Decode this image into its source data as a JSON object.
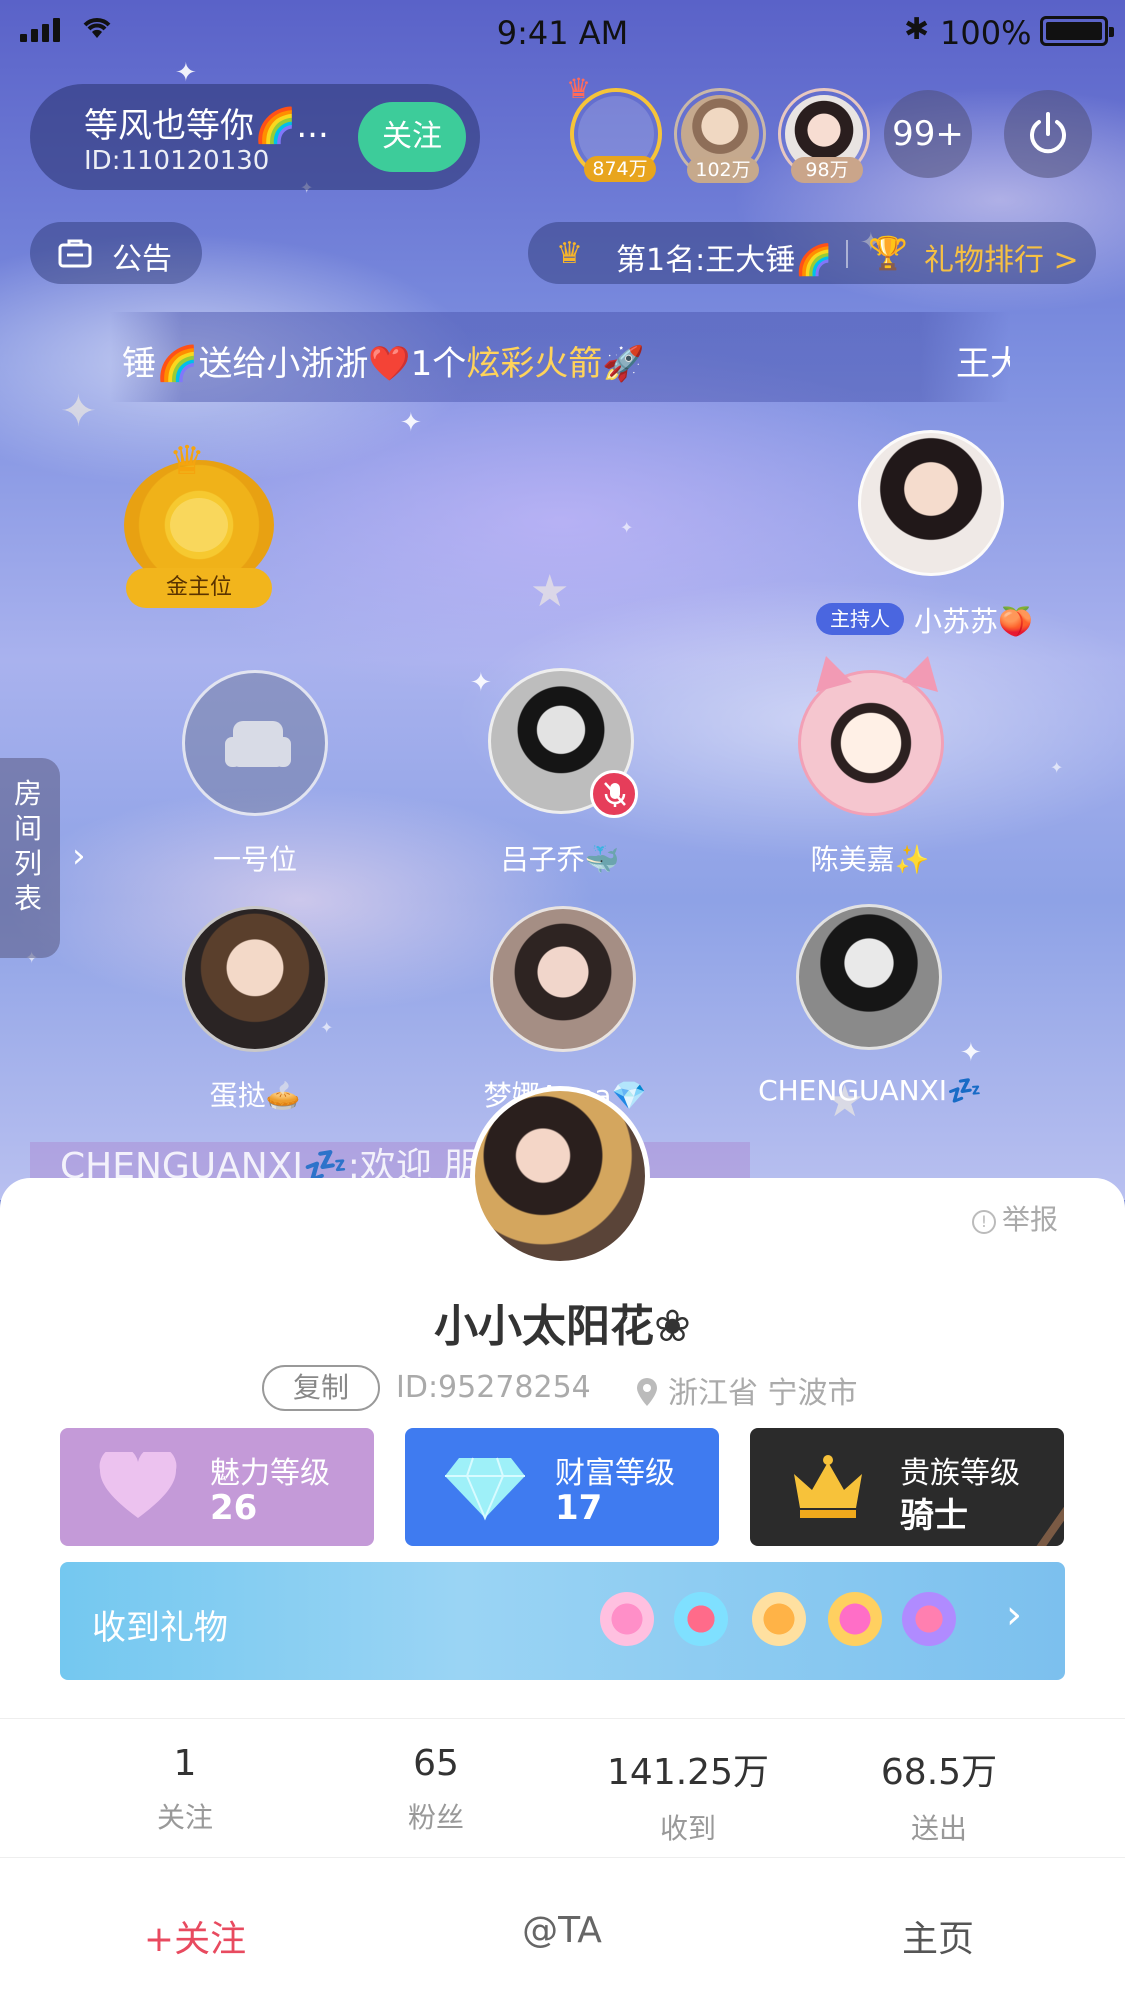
{
  "status_bar": {
    "time": "9:41 AM",
    "battery": "100%"
  },
  "host": {
    "name": "等风也等你🌈...",
    "id": "ID:110120130",
    "follow_label": "关注"
  },
  "top_ranks": [
    {
      "value": "874万"
    },
    {
      "value": "102万"
    },
    {
      "value": "98万"
    }
  ],
  "online_count": "99+",
  "notice_label": "公告",
  "rank_bar": {
    "first": "第1名:王大锤🌈",
    "gift_rank": "礼物排行 >"
  },
  "marquee": {
    "text_pre": "锤🌈送给小浙浙❤️1个",
    "gift_name": "炫彩火箭",
    "text_post": "🚀",
    "next": "王大"
  },
  "boss_seat": {
    "label": "金主位"
  },
  "host_seat": {
    "tag": "主持人",
    "name": "小苏苏🍑"
  },
  "seats": [
    {
      "name": "一号位"
    },
    {
      "name": "吕子乔🐳"
    },
    {
      "name": "陈美嘉✨"
    },
    {
      "name": "蛋挞🥧"
    },
    {
      "name": "梦娜Anna💎"
    },
    {
      "name": "CHENGUANXI💤"
    }
  ],
  "room_list_label": "房间列表",
  "welcome_text": "CHENGUANXI💤:欢迎 朋",
  "profile": {
    "report": "举报",
    "name": "小小太阳花❀",
    "copy": "复制",
    "id": "ID:95278254",
    "location": "浙江省 宁波市",
    "levels": {
      "charm": {
        "title": "魅力等级",
        "value": "26",
        "color": "#c49ad8"
      },
      "wealth": {
        "title": "财富等级",
        "value": "17",
        "color": "#3f7bf0"
      },
      "noble": {
        "title": "贵族等级",
        "value": "骑士",
        "color": "#2b2b2b"
      }
    },
    "gifts_label": "收到礼物",
    "stats": [
      {
        "value": "1",
        "label": "关注"
      },
      {
        "value": "65",
        "label": "粉丝"
      },
      {
        "value": "141.25万",
        "label": "收到"
      },
      {
        "value": "68.5万",
        "label": "送出"
      }
    ],
    "actions": {
      "follow": "+关注",
      "at": "@TA",
      "home": "主页"
    }
  },
  "colors": {
    "follow_green": "#3dcc9a",
    "accent_red": "#e84a5f",
    "gold": "#f6b52a"
  }
}
